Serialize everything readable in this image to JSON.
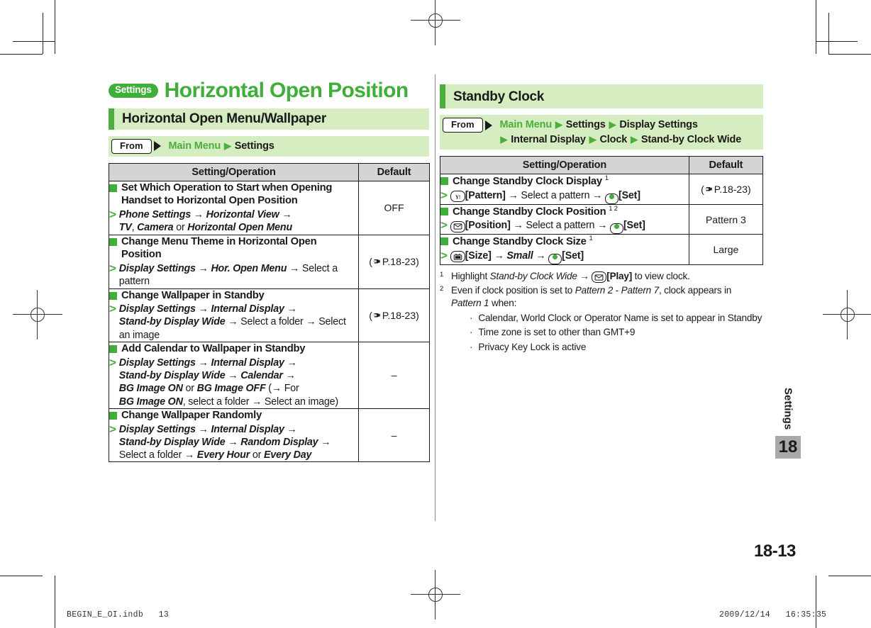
{
  "chapter": {
    "badge": "Settings",
    "title": "Horizontal Open Position"
  },
  "left": {
    "section_title": "Horizontal Open Menu/Wallpaper",
    "from": {
      "label": "From",
      "path_line1_a": "Main Menu",
      "path_line1_b": "Settings"
    },
    "table": {
      "headers": {
        "operation": "Setting/Operation",
        "default": "Default"
      },
      "rows": [
        {
          "head": "Set Which Operation to Start when Opening Handset to Horizontal Open Position",
          "steps": "Phone Settings → Horizontal View → TV, Camera or Horizontal Open Menu",
          "default": "OFF",
          "default_ref": ""
        },
        {
          "head": "Change Menu Theme in Horizontal Open Position",
          "steps": "Display Settings → Hor. Open Menu → Select a pattern",
          "default": "",
          "default_ref": "P.18-23"
        },
        {
          "head": "Change Wallpaper in Standby",
          "steps": "Display Settings → Internal Display → Stand-by Display Wide → Select a folder → Select an image",
          "default": "",
          "default_ref": "P.18-23"
        },
        {
          "head": "Add Calendar to Wallpaper in Standby",
          "steps": "Display Settings → Internal Display → Stand-by Display Wide → Calendar → BG Image ON or BG Image OFF (→ For BG Image ON, select a folder → Select an image)",
          "default": "–",
          "default_ref": ""
        },
        {
          "head": "Change Wallpaper Randomly",
          "steps": "Display Settings → Internal Display → Stand-by Display Wide → Random Display → Select a folder → Every Hour or Every Day",
          "default": "–",
          "default_ref": ""
        }
      ]
    }
  },
  "right": {
    "section_title": "Standby Clock",
    "from": {
      "label": "From",
      "path_line1_a": "Main Menu",
      "path_line1_b": "Settings",
      "path_line1_c": "Display Settings",
      "path_line2_a": "Internal Display",
      "path_line2_b": "Clock",
      "path_line2_c": "Stand-by Clock Wide"
    },
    "table": {
      "headers": {
        "operation": "Setting/Operation",
        "default": "Default"
      },
      "rows": [
        {
          "head": "Change Standby Clock Display",
          "head_notes": "1",
          "key_icon": "yahoo-key-icon",
          "key_label": "[Pattern]",
          "step_mid": "Select a pattern",
          "set_label": "[Set]",
          "default": "",
          "default_ref": "P.18-23"
        },
        {
          "head": "Change Standby Clock Position",
          "head_notes": "1 2",
          "key_icon": "mail-key-icon",
          "key_label": "[Position]",
          "step_mid": "Select a pattern",
          "set_label": "[Set]",
          "default": "Pattern 3",
          "default_ref": ""
        },
        {
          "head": "Change Standby Clock Size",
          "head_notes": "1",
          "key_icon": "tv-key-icon",
          "key_label": "[Size]",
          "step_mid": "Small",
          "step_mid_italic": true,
          "set_label": "[Set]",
          "default": "Large",
          "default_ref": ""
        }
      ]
    },
    "footnotes": [
      {
        "num": "1",
        "text_a": "Highlight ",
        "text_b": "Stand-by Clock Wide",
        "text_c": "[Play]",
        "text_d": " to view clock.",
        "key_icon": "mail-key-icon"
      },
      {
        "num": "2",
        "text_a": "Even if clock position is set to ",
        "text_b": "Pattern 2",
        "text_c": " - ",
        "text_d": "Pattern 7",
        "text_e": ", clock appears in ",
        "text_f": "Pattern 1",
        "text_g": " when:",
        "bullets": [
          "Calendar, World Clock or Operator Name is set to appear in Standby",
          "Time zone is set to other than GMT+9",
          "Privacy Key Lock is active"
        ]
      }
    ]
  },
  "side_tab": {
    "label": "Settings",
    "number": "18"
  },
  "page_number": "18-13",
  "footer": {
    "file": "BEGIN_E_OI.indb   13",
    "date": "2009/12/14   16:35:35"
  },
  "colors": {
    "brand_green": "#3fae3a",
    "light_green": "#d6ecc1",
    "bar_green": "#4cae3f",
    "header_gray": "#d4d4d4",
    "tab_gray": "#a9a9a9"
  }
}
